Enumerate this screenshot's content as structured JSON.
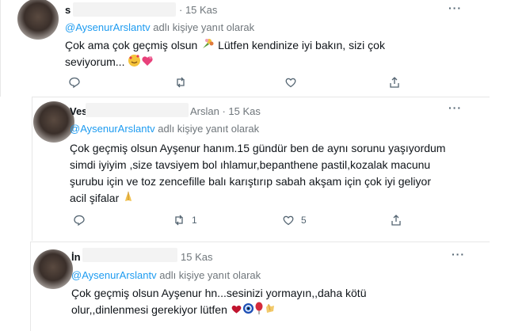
{
  "tweets": [
    {
      "name_fragment": "s",
      "time": "· 15 Kas",
      "reply_to_handle": "@AysenurArslantv",
      "reply_to_suffix": " adlı kişiye yanıt olarak",
      "lines": [
        "Çok ama çok geçmiş olsun",
        "Lütfen kendinize iyi bakın, sizi çok",
        "seviyorum..."
      ],
      "retweet_count": "",
      "like_count": "",
      "icons": [
        "bouquet-emoji",
        "smiling-hearts-emoji",
        "two-hearts-emoji"
      ]
    },
    {
      "name_fragment": "Ves",
      "name_suffix": "Arslan · 15 Kas",
      "reply_to_handle": "@AysenurArslantv",
      "reply_to_suffix": " adlı kişiye yanıt olarak",
      "lines": [
        "Çok geçmiş olsun Ayşenur hanım.15 gündür ben de aynı sorunu yaşıyordum",
        "simdi iyiyim ,size tavsiyem bol ıhlamur,bepanthene pastil,kozalak macunu",
        "şurubu için ve toz zencefille balı karıştırıp sabah akşam için çok iyi geliyor",
        "acil şifalar"
      ],
      "retweet_count": "1",
      "like_count": "5",
      "icons": [
        "praying-hands-emoji"
      ]
    },
    {
      "name_fragment": "İn",
      "time": "15 Kas",
      "reply_to_handle": "@AysenurArslantv",
      "reply_to_suffix": " adlı kişiye yanıt olarak",
      "lines": [
        "Çok geçmiş olsun Ayşenur hn...sesinizi yormayın,,daha kötü",
        "olur,,dinlenmesi gerekiyor lütfen"
      ],
      "retweet_count": "",
      "like_count": "",
      "icons": [
        "red-heart-emoji",
        "nazar-amulet-emoji",
        "balloon-emoji",
        "clapping-hands-emoji"
      ]
    }
  ],
  "colors": {
    "mention": "#1d9bf0",
    "muted": "#6f767b",
    "text": "#0f1419",
    "heart": "#c0152f"
  }
}
